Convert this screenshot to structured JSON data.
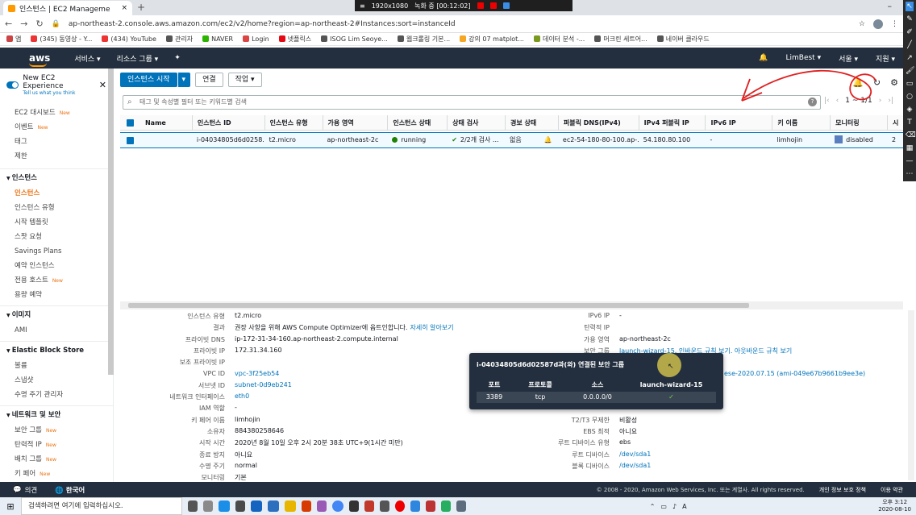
{
  "browser": {
    "tab_title": "인스턴스 | EC2 Manageme",
    "new_tab": "+",
    "url": "ap-northeast-2.console.aws.amazon.com/ec2/v2/home?region=ap-northeast-2#Instances:sort=instanceId",
    "recording": {
      "resolution": "1920x1080",
      "status": "녹화 중 [00:12:02]"
    },
    "bookmarks": [
      {
        "label": "앱",
        "color": "#c44"
      },
      {
        "label": "(345) 동영상 - Y...",
        "color": "#e33"
      },
      {
        "label": "(434) YouTube",
        "color": "#e33"
      },
      {
        "label": "관리자",
        "color": "#555"
      },
      {
        "label": "NAVER",
        "color": "#2db400"
      },
      {
        "label": "Login",
        "color": "#d44"
      },
      {
        "label": "넷플릭스",
        "color": "#e50914"
      },
      {
        "label": "ISOG Lim Seoye...",
        "color": "#555"
      },
      {
        "label": "웹크롤링 기본...",
        "color": "#555"
      },
      {
        "label": "강의 07 matplot...",
        "color": "#f5a623"
      },
      {
        "label": "데이터 분석 -...",
        "color": "#7a9a1f"
      },
      {
        "label": "머크린 세트어...",
        "color": "#555"
      },
      {
        "label": "네이버 클라우드",
        "color": "#555"
      }
    ]
  },
  "aws_header": {
    "logo": "aws",
    "services": "서비스 ▾",
    "resource_groups": "리소스 그룹 ▾",
    "pin": "✦",
    "user": "LimBest ▾",
    "region": "서울 ▾",
    "support": "지원 ▾"
  },
  "sidebar": {
    "new_experience": "New EC2 Experience",
    "new_experience_sub": "Tell us what you think",
    "new_badge": "New",
    "top_items": [
      {
        "label": "EC2 대시보드",
        "new": true
      },
      {
        "label": "이벤트",
        "new": true
      },
      {
        "label": "태그",
        "new": false
      },
      {
        "label": "제한",
        "new": false
      }
    ],
    "sections": [
      {
        "title": "인스턴스",
        "items": [
          {
            "label": "인스턴스",
            "new": false,
            "active": true
          },
          {
            "label": "인스턴스 유형",
            "new": false
          },
          {
            "label": "시작 템플릿",
            "new": false
          },
          {
            "label": "스팟 요청",
            "new": false
          },
          {
            "label": "Savings Plans",
            "new": false
          },
          {
            "label": "예약 인스턴스",
            "new": false
          },
          {
            "label": "전용 호스트",
            "new": true
          },
          {
            "label": "용량 예약",
            "new": false
          }
        ]
      },
      {
        "title": "이미지",
        "items": [
          {
            "label": "AMI",
            "new": false
          }
        ]
      },
      {
        "title": "Elastic Block Store",
        "items": [
          {
            "label": "볼륨",
            "new": false
          },
          {
            "label": "스냅샷",
            "new": false
          },
          {
            "label": "수명 주기 관리자",
            "new": false
          }
        ]
      },
      {
        "title": "네트워크 및 보안",
        "items": [
          {
            "label": "보안 그룹",
            "new": true
          },
          {
            "label": "탄력적 IP",
            "new": true
          },
          {
            "label": "배치 그룹",
            "new": true
          },
          {
            "label": "키 페어",
            "new": true
          },
          {
            "label": "네트워크 인터페이스",
            "new": false
          }
        ]
      }
    ]
  },
  "toolbar": {
    "launch": "인스턴스 시작",
    "connect": "연결",
    "actions": "작업 ▾"
  },
  "search": {
    "placeholder": "태그 및 속성별 필터 또는 키워드별 검색",
    "help": "?"
  },
  "pager": {
    "first": "|‹",
    "prev": "‹",
    "range": "1 ~ 1/1",
    "next": "›",
    "last": "›|"
  },
  "table": {
    "headers": [
      "Name",
      "인스턴스 ID",
      "인스턴스 유형",
      "가용 영역",
      "인스턴스 상태",
      "상태 검사",
      "경보 상태",
      "퍼블릭 DNS(IPv4)",
      "IPv4 퍼블릭 IP",
      "IPv6 IP",
      "키 이름",
      "모니터링",
      "시"
    ],
    "row": {
      "name": "",
      "id": "i-04034805d6d0258...",
      "type": "t2.micro",
      "az": "ap-northeast-2c",
      "state": "running",
      "checks": "2/2개 검사 ...",
      "alarm": "없음",
      "dns": "ec2-54-180-80-100.ap-...",
      "ip": "54.180.80.100",
      "ipv6": "-",
      "key": "limhojin",
      "monitoring": "disabled",
      "launch": "2"
    }
  },
  "details": {
    "left": [
      {
        "label": "인스턴스 유형",
        "value": "t2.micro",
        "link": false
      },
      {
        "label": "결과",
        "value": "권장 사항을 위해 AWS Compute Optimizer에 옵트인합니다.",
        "link": false,
        "extra": "자세히 알아보기"
      },
      {
        "label": "프라이빗 DNS",
        "value": "ip-172-31-34-160.ap-northeast-2.compute.internal",
        "link": false
      },
      {
        "label": "프라이빗 IP",
        "value": "172.31.34.160",
        "link": false
      },
      {
        "label": "보조 프라이빗 IP",
        "value": "",
        "link": false
      },
      {
        "label": "VPC ID",
        "value": "vpc-3f25eb54",
        "link": true
      },
      {
        "label": "서브넷 ID",
        "value": "subnet-0d9eb241",
        "link": true
      },
      {
        "label": "네트워크 인터페이스",
        "value": "eth0",
        "link": true
      },
      {
        "label": "IAM 역할",
        "value": "-",
        "link": false
      },
      {
        "label": "키 페어 이름",
        "value": "limhojin",
        "link": false
      },
      {
        "label": "소유자",
        "value": "884380258646",
        "link": false
      },
      {
        "label": "시작 시간",
        "value": "2020년 8월 10일 오후 2시 20분 38초 UTC+9(1시간 미만)",
        "link": false
      },
      {
        "label": "종료 방지",
        "value": "아니요",
        "link": false
      },
      {
        "label": "수명 주기",
        "value": "normal",
        "link": false
      },
      {
        "label": "모니터링",
        "value": "기본",
        "link": false
      }
    ],
    "right": [
      {
        "label": "IPv6 IP",
        "value": "-",
        "link": false
      },
      {
        "label": "탄력적 IP",
        "value": "",
        "link": false
      },
      {
        "label": "가용 영역",
        "value": "ap-northeast-2c",
        "link": false
      },
      {
        "label": "보안 그룹",
        "value": "launch-wizard-15. 인바운드 규칙 보기. 아웃바운드 규칙 보기",
        "link": true
      },
      {
        "label": "",
        "value": "",
        "link": false
      },
      {
        "label": "",
        "value": "ese-2020.07.15 (ami-049e67b9661b9ee3e)",
        "link": true
      },
      {
        "label": "",
        "value": "",
        "link": false
      },
      {
        "label": "",
        "value": "",
        "link": false
      },
      {
        "label": "",
        "value": "",
        "link": false
      },
      {
        "label": "T2/T3 무제한",
        "value": "비활성",
        "link": false
      },
      {
        "label": "EBS 최적",
        "value": "아니요",
        "link": false
      },
      {
        "label": "루트 디바이스 유형",
        "value": "ebs",
        "link": false
      },
      {
        "label": "루트 디바이스",
        "value": "/dev/sda1",
        "link": true
      },
      {
        "label": "블록 디바이스",
        "value": "/dev/sda1",
        "link": true
      }
    ]
  },
  "popup": {
    "title": "i-04034805d6d02587d과(와) 연결된 보안 그룹",
    "headers": [
      "포트",
      "프로토콜",
      "소스",
      "launch-wizard-15"
    ],
    "row": {
      "port": "3389",
      "protocol": "tcp",
      "source": "0.0.0.0/0",
      "ok": "✓"
    }
  },
  "footer": {
    "feedback": "의견",
    "language": "한국어",
    "copyright": "© 2008 - 2020, Amazon Web Services, Inc. 또는 계열사. All rights reserved.",
    "privacy": "개인 정보 보호 정책",
    "terms": "이용 약관"
  },
  "taskbar": {
    "search_placeholder": "검색하려면 여기에 입력하십시오.",
    "time": "오후 3:12",
    "date": "2020-08-10"
  }
}
